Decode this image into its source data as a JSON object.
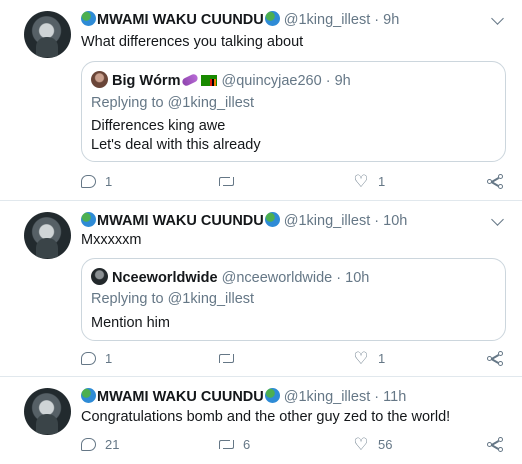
{
  "tweets": [
    {
      "author_name": "MWAMI WAKU CUUNDU",
      "handle": "@1king_illest",
      "separator": "·",
      "time": "9h",
      "text": "What differences you talking about",
      "quote": {
        "name": "Big Wórm",
        "handle": "@quincyjae260",
        "separator": "·",
        "time": "9h",
        "replying_prefix": "Replying to",
        "replying_to": "@1king_illest",
        "line1": "Differences king awe",
        "line2": "Let's deal with this already"
      },
      "replies": "1",
      "retweets": "",
      "likes": "1"
    },
    {
      "author_name": "MWAMI WAKU CUUNDU",
      "handle": "@1king_illest",
      "separator": "·",
      "time": "10h",
      "text": "Mxxxxxm",
      "quote": {
        "name": "Nceeworldwide",
        "handle": "@nceeworldwide",
        "separator": "·",
        "time": "10h",
        "replying_prefix": "Replying to",
        "replying_to": "@1king_illest",
        "line1": "Mention him"
      },
      "replies": "1",
      "retweets": "",
      "likes": "1"
    },
    {
      "author_name": "MWAMI WAKU CUUNDU",
      "handle": "@1king_illest",
      "separator": "·",
      "time": "11h",
      "text": "Congratulations bomb and the other guy zed to the world!",
      "replies": "21",
      "retweets": "6",
      "likes": "56"
    }
  ],
  "icons": {
    "reply": "reply-icon",
    "retweet": "retweet-icon",
    "like": "heart-icon",
    "share": "share-icon",
    "more": "chevron-down-icon",
    "globe": "globe-emoji"
  },
  "colors": {
    "text": "#14171a",
    "secondary": "#657786",
    "border": "#ccd6dd",
    "divider": "#e1e8ed"
  }
}
